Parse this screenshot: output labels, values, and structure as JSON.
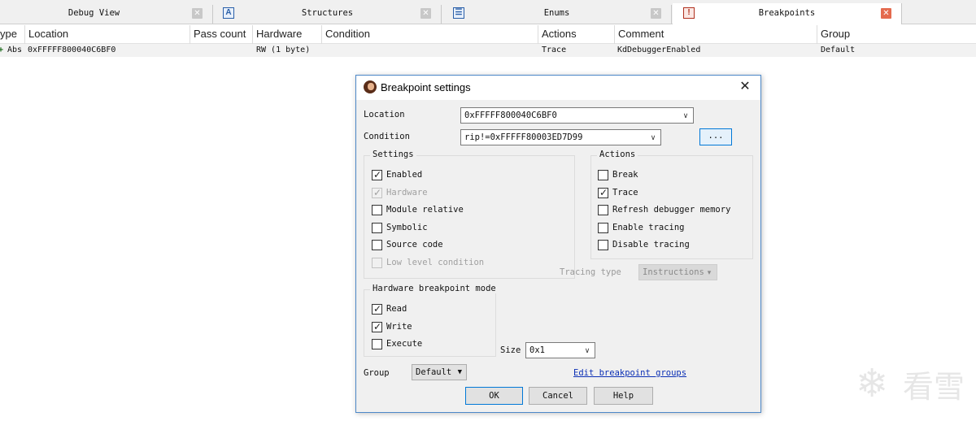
{
  "tabs": [
    {
      "label": "Debug View",
      "icon": "debug-icon",
      "active": false
    },
    {
      "label": "Structures",
      "icon": "structures-icon",
      "active": false
    },
    {
      "label": "Enums",
      "icon": "enums-icon",
      "active": false
    },
    {
      "label": "Breakpoints",
      "icon": "breakpoints-icon",
      "active": true
    }
  ],
  "table": {
    "columns": [
      "ype",
      "Location",
      "Pass count",
      "Hardware",
      "Condition",
      "Actions",
      "Comment",
      "Group"
    ],
    "rows": [
      {
        "type": "Abs",
        "location": "0xFFFFF800040C6BF0",
        "pass_count": "",
        "hardware": "RW (1 byte)",
        "condition": "",
        "actions": "Trace",
        "comment": "KdDebuggerEnabled",
        "group": "Default"
      }
    ]
  },
  "dialog": {
    "title": "Breakpoint settings",
    "location_label": "Location",
    "location_value": "0xFFFFF800040C6BF0",
    "condition_label": "Condition",
    "condition_value": "rip!=0xFFFFF80003ED7D99",
    "ellipsis_label": "...",
    "settings": {
      "title": "Settings",
      "items": [
        {
          "label": "Enabled",
          "checked": true,
          "disabled": false
        },
        {
          "label": "Hardware",
          "checked": true,
          "disabled": true
        },
        {
          "label": "Module relative",
          "checked": false,
          "disabled": false
        },
        {
          "label": "Symbolic",
          "checked": false,
          "disabled": false
        },
        {
          "label": "Source code",
          "checked": false,
          "disabled": false
        },
        {
          "label": "Low level condition",
          "checked": false,
          "disabled": true
        }
      ]
    },
    "actions": {
      "title": "Actions",
      "items": [
        {
          "label": "Break",
          "checked": false
        },
        {
          "label": "Trace",
          "checked": true
        },
        {
          "label": "Refresh debugger memory",
          "checked": false
        },
        {
          "label": "Enable tracing",
          "checked": false
        },
        {
          "label": "Disable tracing",
          "checked": false
        }
      ]
    },
    "tracing_type_label": "Tracing type",
    "tracing_type_value": "Instructions",
    "hw_mode": {
      "title": "Hardware breakpoint mode",
      "items": [
        {
          "label": "Read",
          "checked": true
        },
        {
          "label": "Write",
          "checked": true
        },
        {
          "label": "Execute",
          "checked": false
        }
      ]
    },
    "size_label": "Size",
    "size_value": "0x1",
    "group_label": "Group",
    "group_value": "Default",
    "edit_groups_link": "Edit breakpoint groups",
    "ok_label": "OK",
    "cancel_label": "Cancel",
    "help_label": "Help"
  },
  "watermark": {
    "text": "看雪"
  }
}
